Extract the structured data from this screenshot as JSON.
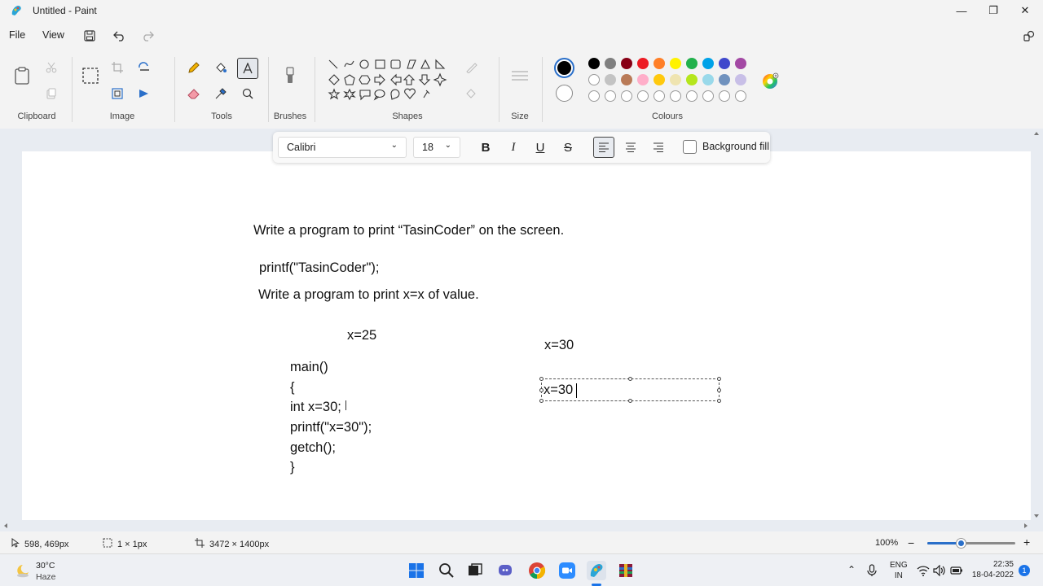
{
  "window": {
    "title": "Untitled - Paint",
    "minimize": "—",
    "maximize": "❐",
    "close": "✕"
  },
  "menu": {
    "file": "File",
    "view": "View"
  },
  "ribbon": {
    "groups": {
      "clipboard": "Clipboard",
      "image": "Image",
      "tools": "Tools",
      "brushes": "Brushes",
      "shapes": "Shapes",
      "size": "Size",
      "colours": "Colours"
    },
    "colors": {
      "row1": [
        "#000000",
        "#7f7f7f",
        "#880015",
        "#ed1c24",
        "#ff7f27",
        "#fff200",
        "#22b14c",
        "#00a2e8",
        "#3f48cc",
        "#a349a4"
      ],
      "row2": [
        "#ffffff",
        "#c3c3c3",
        "#b97a57",
        "#ffaec9",
        "#ffc90e",
        "#efe4b0",
        "#b5e61d",
        "#99d9ea",
        "#7092be",
        "#c8bfe7"
      ],
      "row3_empty_count": 10
    }
  },
  "text_toolbar": {
    "font": "Calibri",
    "size": "18",
    "bold": "B",
    "italic": "I",
    "underline": "U",
    "strike": "S",
    "background_fill": "Background fill"
  },
  "canvas_text": {
    "line1": "Write a program to print “TasinCoder” on the screen.",
    "line2": "printf(\"TasinCoder\");",
    "line3": "Write a program to print x=x of value.",
    "x25": "x=25",
    "x30a": "x=30",
    "code": [
      "main()",
      "{",
      "int x=30;",
      "printf(\"x=30\");",
      "getch();",
      "}"
    ],
    "textbox_value": "x=30"
  },
  "status": {
    "cursor": "598, 469px",
    "selection": "1 × 1px",
    "canvas_size": "3472 × 1400px",
    "zoom": "100%"
  },
  "taskbar": {
    "weather_temp": "30°C",
    "weather_desc": "Haze",
    "lang1": "ENG",
    "lang2": "IN",
    "time": "22:35",
    "date": "18-04-2022",
    "notif_count": "1"
  }
}
